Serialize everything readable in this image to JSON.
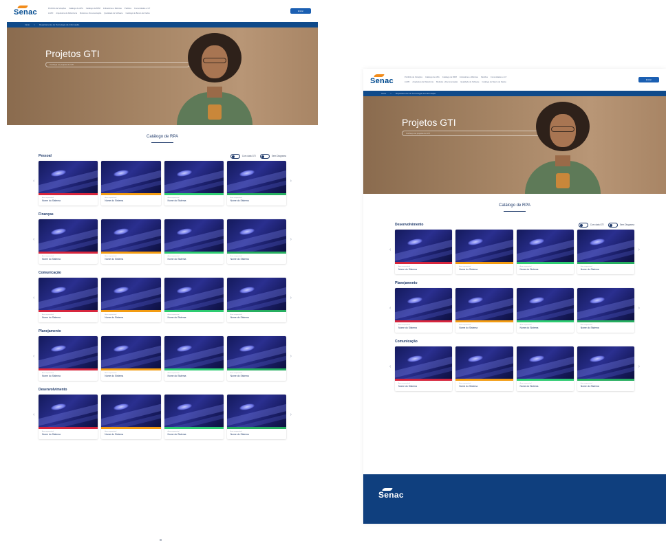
{
  "header": {
    "logo_text": "Senac",
    "nav_row1": [
      "Portifólio de Soluções",
      "Catálogo de APIs",
      "Catálogo de BPM",
      "Indicadores e Métricas",
      "Padrões",
      "Comunidades e GT"
    ],
    "nav_row2": [
      "LGPD",
      "Arquitetura de Referência",
      "Modelos e Documentação",
      "Qualidade de Software",
      "Catálogo de Banco de Dados"
    ],
    "login_label": "Entrar"
  },
  "breadcrumb": [
    "Início",
    ">",
    "Departamento de Tecnologia da Informação"
  ],
  "hero": {
    "title": "Projetos GTI",
    "subtitle": "Conheça os projetos do GTI"
  },
  "catalog": {
    "title": "Catálogo de RPA",
    "toggle_labels": [
      "Com data GTI",
      "Sem Diagrama"
    ]
  },
  "colors": {
    "strip_red": "#d7263d",
    "strip_orange": "#f39c12",
    "strip_green": "#27ae60",
    "strip_mint": "#2ecc71",
    "brand_blue": "#0f3f7e",
    "accent_orange": "#f28c1b"
  },
  "card_title": "Nome do Sistema",
  "card_meta": "Área responsável",
  "arrows": {
    "prev": "‹",
    "next": "›"
  },
  "left_sections": [
    {
      "name": "Pessoal",
      "show_toggles": true
    },
    {
      "name": "Finanças",
      "show_toggles": false
    },
    {
      "name": "Comunicação",
      "show_toggles": false
    },
    {
      "name": "Planejamento",
      "show_toggles": false
    },
    {
      "name": "Desenvolvimento",
      "show_toggles": false
    }
  ],
  "right_sections": [
    {
      "name": "Desenvolvimento",
      "show_toggles": true
    },
    {
      "name": "Planejamento",
      "show_toggles": false
    },
    {
      "name": "Comunicação",
      "show_toggles": false
    }
  ],
  "footer": {
    "logo_text": "Senac"
  }
}
